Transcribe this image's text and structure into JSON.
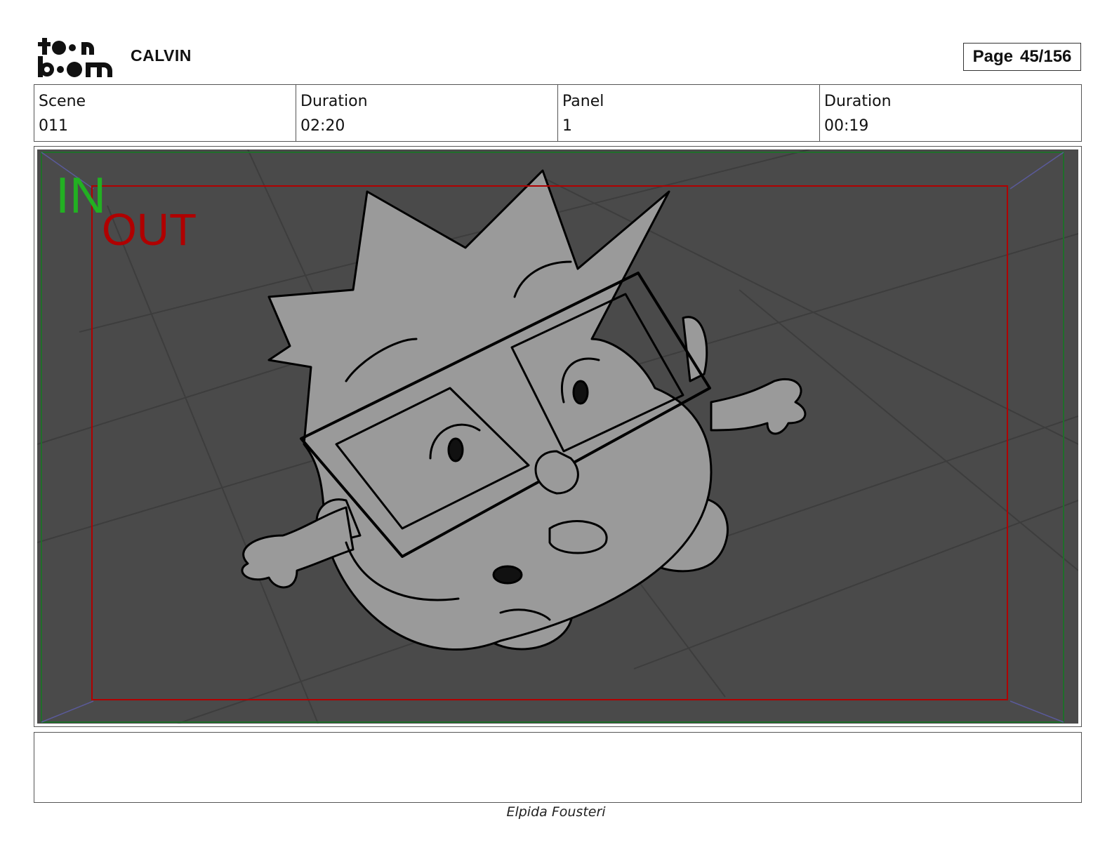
{
  "header": {
    "logo_name": "toonboom-logo",
    "project_title": "CALVIN",
    "page_label": "Page",
    "page_number": "45/156"
  },
  "info": {
    "scene_label": "Scene",
    "scene_value": "011",
    "scene_duration_label": "Duration",
    "scene_duration_value": "02:20",
    "panel_label": "Panel",
    "panel_value": "1",
    "panel_duration_label": "Duration",
    "panel_duration_value": "00:19"
  },
  "panel": {
    "in_label": "IN",
    "out_label": "OUT",
    "in_color": "#22b022",
    "out_color": "#b00000",
    "background_color": "#4a4a4a",
    "character_fill": "#9a9a9a"
  },
  "notes": {
    "text": ""
  },
  "footer": {
    "artist": "Elpida Fousteri"
  }
}
